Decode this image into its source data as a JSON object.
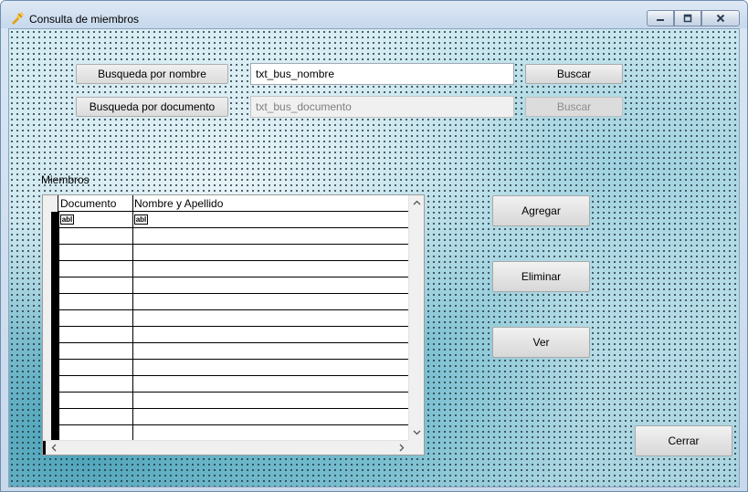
{
  "window": {
    "title": "Consulta de miembros",
    "controls": {
      "minimize": "minimize-icon",
      "maximize": "maximize-icon",
      "close": "close-icon"
    }
  },
  "search": {
    "by_name": {
      "label": "Busqueda por nombre",
      "value": "txt_bus_nombre",
      "button": "Buscar"
    },
    "by_document": {
      "label": "Busqueda por documento",
      "value": "txt_bus_documento",
      "button": "Buscar"
    }
  },
  "members": {
    "label": "Miembros",
    "columns": [
      "Documento",
      "Nombre y Apellido"
    ],
    "cell_placeholder": "abl",
    "row_count": 14
  },
  "actions": {
    "add": "Agregar",
    "delete": "Eliminar",
    "view": "Ver",
    "close": "Cerrar"
  },
  "colors": {
    "client_background": "#cfe6ee",
    "button_face": "#e4e4e4",
    "disabled_text": "#8d8d8d"
  }
}
